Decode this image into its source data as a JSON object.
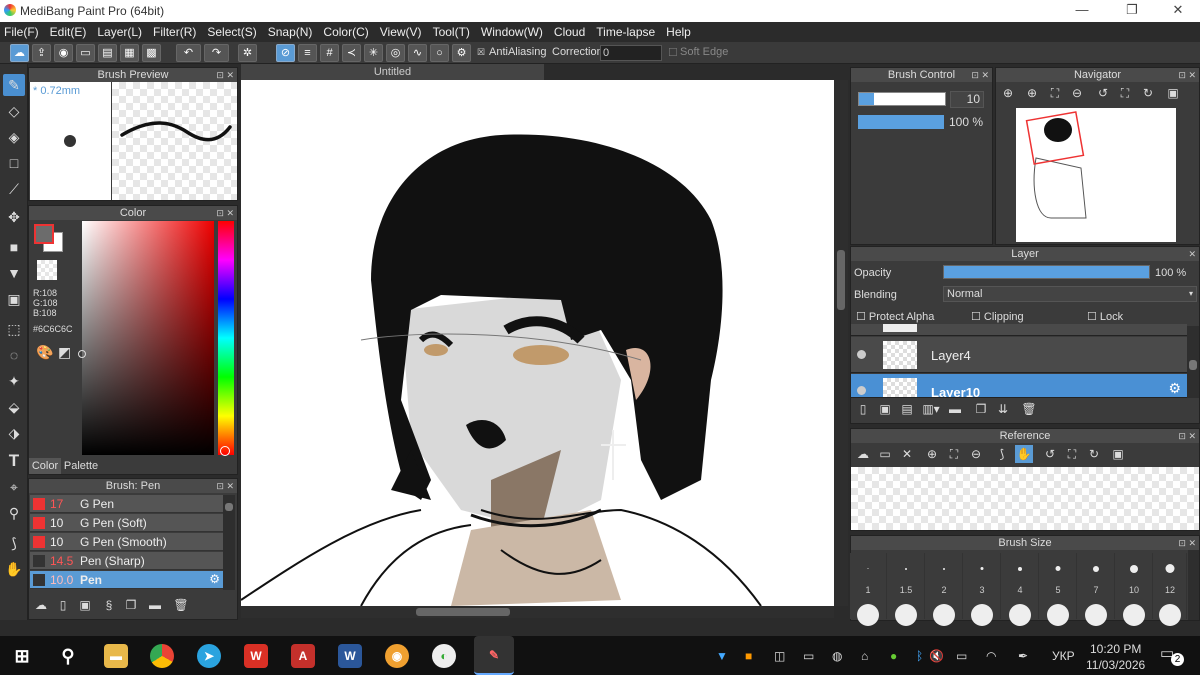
{
  "window": {
    "title": "MediBang Paint Pro (64bit)",
    "minimize": "—",
    "maximize": "❐",
    "close": "✕"
  },
  "menu": [
    "File(F)",
    "Edit(E)",
    "Layer(L)",
    "Filter(R)",
    "Select(S)",
    "Snap(N)",
    "Color(C)",
    "View(V)",
    "Tool(T)",
    "Window(W)",
    "Cloud",
    "Time-lapse",
    "Help"
  ],
  "toolbar": {
    "antialias_label": "AntiAliasing",
    "correction_label": "Correction",
    "correction_value": "0",
    "soft_edge_label": "Soft Edge"
  },
  "brush_preview": {
    "title": "Brush Preview",
    "size": "* 0.72mm"
  },
  "color_panel": {
    "title": "Color",
    "r": "R:108",
    "g": "G:108",
    "b": "B:108",
    "hex": "#6C6C6C",
    "tab_color": "Color",
    "tab_palette": "Palette",
    "current_color": "#6c6c6c"
  },
  "brush_panel": {
    "title": "Brush: Pen",
    "items": [
      {
        "size": "17",
        "name": "G Pen",
        "color": "#e33"
      },
      {
        "size": "10",
        "name": "G Pen (Soft)",
        "color": "#e33"
      },
      {
        "size": "10",
        "name": "G Pen (Smooth)",
        "color": "#e33"
      },
      {
        "size": "14.5",
        "name": "Pen (Sharp)",
        "color": "#333"
      },
      {
        "size": "10.0",
        "name": "Pen",
        "color": "#333"
      }
    ]
  },
  "canvas": {
    "tab": "Untitled"
  },
  "brush_control": {
    "title": "Brush Control",
    "size_value": "10",
    "opacity_value": "100 %",
    "size_fraction": 0.17,
    "opacity_fraction": 1.0
  },
  "navigator": {
    "title": "Navigator"
  },
  "layer_panel": {
    "title": "Layer",
    "opacity_label": "Opacity",
    "opacity_value": "100 %",
    "opacity_fraction": 1.0,
    "blending_label": "Blending",
    "blending_value": "Normal",
    "protect_alpha": "Protect Alpha",
    "clipping": "Clipping",
    "lock": "Lock",
    "layers": [
      {
        "name": "Layer4",
        "selected": false
      },
      {
        "name": "Layer10",
        "selected": true
      }
    ]
  },
  "reference": {
    "title": "Reference"
  },
  "brush_size": {
    "title": "Brush Size",
    "sizes": [
      "1",
      "1.5",
      "2",
      "3",
      "4",
      "5",
      "7",
      "10",
      "12"
    ]
  },
  "taskbar": {
    "lang": "УКР",
    "time": "10:20 PM",
    "date": "11/03/2026",
    "notifications": "2"
  }
}
